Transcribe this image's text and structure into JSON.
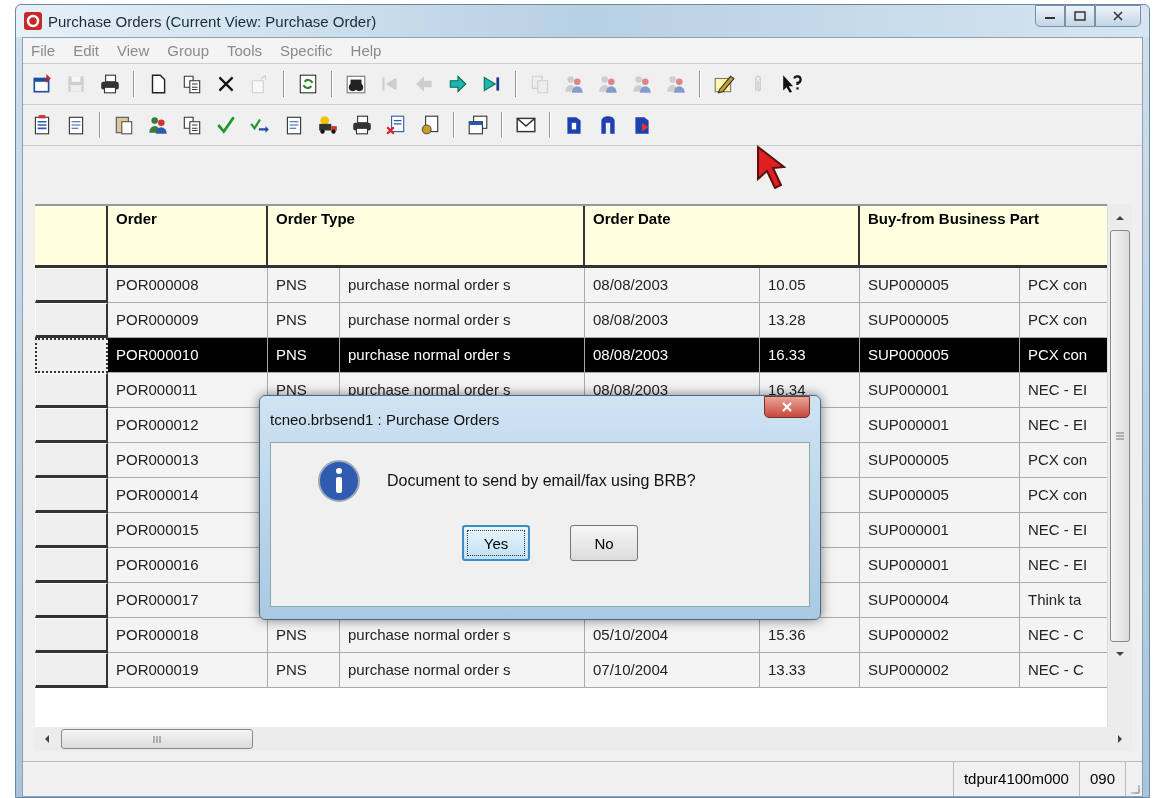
{
  "window": {
    "title": "Purchase Orders (Current View: Purchase Order)"
  },
  "menu": [
    "File",
    "Edit",
    "View",
    "Group",
    "Tools",
    "Specific",
    "Help"
  ],
  "toolbars": [
    {
      "groups": [
        {
          "buttons": [
            {
              "kind": "winsave",
              "disabled": false
            },
            {
              "kind": "save",
              "disabled": true
            },
            {
              "kind": "printer",
              "disabled": false
            }
          ]
        },
        {
          "buttons": [
            {
              "kind": "document",
              "disabled": false
            },
            {
              "kind": "copy",
              "disabled": false
            },
            {
              "kind": "delete",
              "disabled": false
            },
            {
              "kind": "export",
              "disabled": true
            }
          ]
        },
        {
          "buttons": [
            {
              "kind": "refresh",
              "disabled": false
            }
          ]
        },
        {
          "buttons": [
            {
              "kind": "binoculars",
              "disabled": false
            },
            {
              "kind": "first",
              "disabled": true
            },
            {
              "kind": "previous",
              "disabled": true
            },
            {
              "kind": "next",
              "disabled": false
            },
            {
              "kind": "last",
              "disabled": false
            }
          ]
        },
        {
          "buttons": [
            {
              "kind": "pages",
              "disabled": true
            },
            {
              "kind": "people",
              "disabled": true
            },
            {
              "kind": "people",
              "disabled": true
            },
            {
              "kind": "people",
              "disabled": true
            },
            {
              "kind": "people",
              "disabled": true
            }
          ]
        },
        {
          "buttons": [
            {
              "kind": "pencil",
              "disabled": false
            },
            {
              "kind": "paperclip",
              "disabled": true
            },
            {
              "kind": "help",
              "disabled": false
            }
          ]
        }
      ]
    },
    {
      "groups": [
        {
          "buttons": [
            {
              "kind": "list",
              "disabled": false
            },
            {
              "kind": "form",
              "disabled": false
            }
          ]
        },
        {
          "buttons": [
            {
              "kind": "clipboard",
              "disabled": false
            },
            {
              "kind": "people",
              "disabled": false
            },
            {
              "kind": "copy",
              "disabled": false
            },
            {
              "kind": "check",
              "disabled": false
            },
            {
              "kind": "checkarrow",
              "disabled": false
            },
            {
              "kind": "form",
              "disabled": false
            },
            {
              "kind": "truck",
              "disabled": false
            },
            {
              "kind": "printer",
              "disabled": false
            },
            {
              "kind": "xdoc",
              "disabled": false
            },
            {
              "kind": "coins",
              "disabled": false
            }
          ]
        },
        {
          "buttons": [
            {
              "kind": "windows",
              "disabled": false
            }
          ]
        },
        {
          "buttons": [
            {
              "kind": "envelope",
              "disabled": false
            }
          ]
        },
        {
          "buttons": [
            {
              "kind": "bookblue",
              "disabled": false
            },
            {
              "kind": "archblue",
              "disabled": false
            },
            {
              "kind": "bookred",
              "disabled": false
            }
          ]
        }
      ]
    }
  ],
  "table": {
    "columns": [
      {
        "label": "Order"
      },
      {
        "label": "Order Type"
      },
      {
        "label": "Order Date"
      },
      {
        "label": "Buy-from Business Part"
      }
    ],
    "rows": [
      {
        "selected": false,
        "order": "POR000008",
        "type": "PNS",
        "description": "purchase normal order s",
        "date": "08/08/2003",
        "time": "10.05",
        "partner": "SUP000005",
        "partner_name": "PCX con"
      },
      {
        "selected": false,
        "order": "POR000009",
        "type": "PNS",
        "description": "purchase normal order s",
        "date": "08/08/2003",
        "time": "13.28",
        "partner": "SUP000005",
        "partner_name": "PCX con"
      },
      {
        "selected": true,
        "order": "POR000010",
        "type": "PNS",
        "description": "purchase normal order s",
        "date": "08/08/2003",
        "time": "16.33",
        "partner": "SUP000005",
        "partner_name": "PCX con"
      },
      {
        "selected": false,
        "order": "POR000011",
        "type": "PNS",
        "description": "purchase normal order s",
        "date": "08/08/2003",
        "time": "16.34",
        "partner": "SUP000001",
        "partner_name": "NEC - EI"
      },
      {
        "selected": false,
        "order": "POR000012",
        "partner": "SUP000001",
        "partner_name": "NEC - EI"
      },
      {
        "selected": false,
        "order": "POR000013",
        "partner": "SUP000005",
        "partner_name": "PCX con"
      },
      {
        "selected": false,
        "order": "POR000014",
        "partner": "SUP000005",
        "partner_name": "PCX con"
      },
      {
        "selected": false,
        "order": "POR000015",
        "partner": "SUP000001",
        "partner_name": "NEC - EI"
      },
      {
        "selected": false,
        "order": "POR000016",
        "partner": "SUP000001",
        "partner_name": "NEC - EI"
      },
      {
        "selected": false,
        "order": "POR000017",
        "partner": "SUP000004",
        "partner_name": "Think ta"
      },
      {
        "selected": false,
        "order": "POR000018",
        "type": "PNS",
        "description": "purchase normal order s",
        "date": "05/10/2004",
        "time": "15.36",
        "partner": "SUP000002",
        "partner_name": "NEC - C"
      },
      {
        "selected": false,
        "order": "POR000019",
        "type": "PNS",
        "description": "purchase normal order s",
        "date": "07/10/2004",
        "time": "13.33",
        "partner": "SUP000002",
        "partner_name": "NEC - C"
      }
    ]
  },
  "dialog": {
    "title": "tcneo.brbsend1 : Purchase Orders",
    "message": "Document to send by email/fax using BRB?",
    "buttons": [
      {
        "label": "Yes",
        "selected": true
      },
      {
        "label": "No",
        "selected": false
      }
    ]
  },
  "status_bar": [
    "tdpur4100m000",
    "090"
  ]
}
